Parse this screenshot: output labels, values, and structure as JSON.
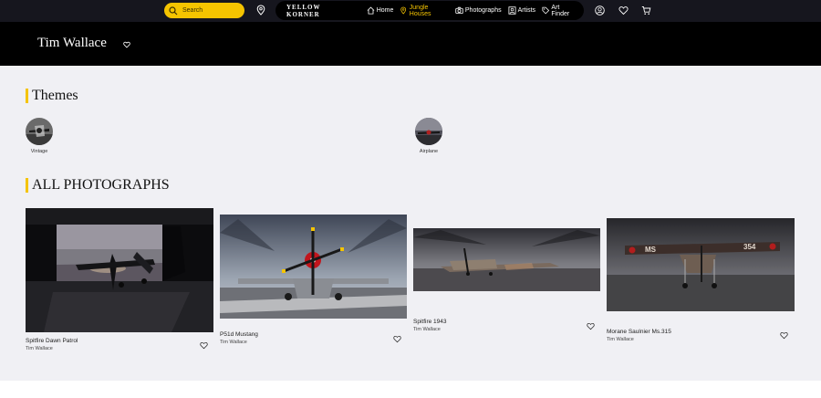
{
  "nav": {
    "search_placeholder": "Search",
    "brand": "YELLOW KORNER",
    "items": [
      {
        "label": "Home",
        "icon": "home-icon"
      },
      {
        "label": "Jungle Houses",
        "icon": "location-pin-icon"
      },
      {
        "label": "Photographs",
        "icon": "camera-icon"
      },
      {
        "label": "Artists",
        "icon": "artist-portrait-icon"
      },
      {
        "label": "Art Finder",
        "icon": "tag-icon"
      }
    ],
    "active_item": "Jungle Houses",
    "accent_color": "#f5c400"
  },
  "artist": {
    "name": "Tim Wallace"
  },
  "themes": {
    "heading": "Themes",
    "items": [
      {
        "label": "Vintage"
      },
      {
        "label": "Airplane"
      }
    ]
  },
  "photographs": {
    "heading": "ALL PHOTOGRAPHS",
    "items": [
      {
        "title": "Spitfire Dawn Patrol",
        "artist": "Tim Wallace"
      },
      {
        "title": "P51d Mustang",
        "artist": "Tim Wallace"
      },
      {
        "title": "Spitfire 1943",
        "artist": "Tim Wallace"
      },
      {
        "title": "Morane Saulnier Ms.315",
        "artist": "Tim Wallace"
      }
    ]
  }
}
